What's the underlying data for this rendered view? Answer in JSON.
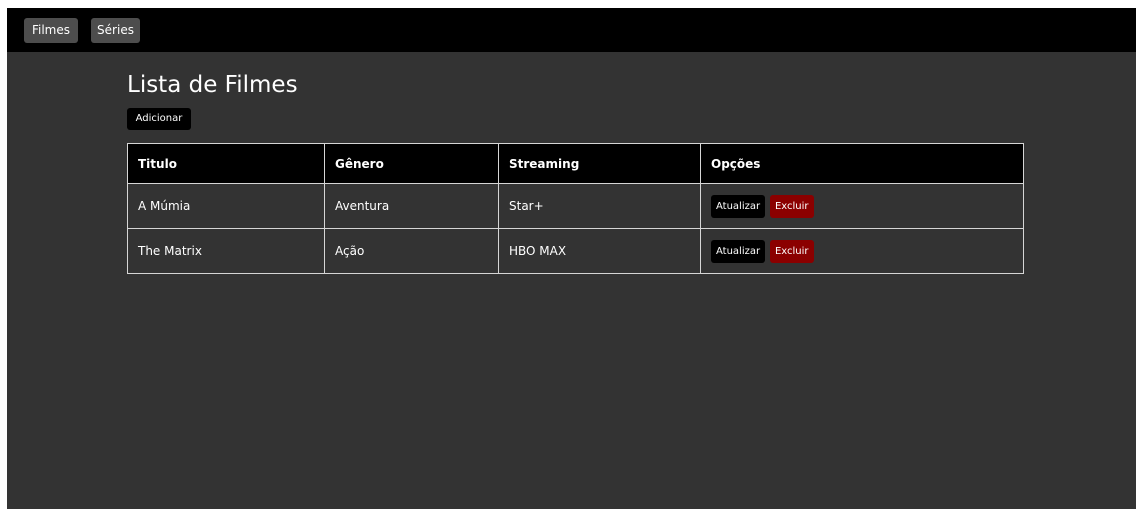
{
  "nav": {
    "filmes_label": "Filmes",
    "series_label": "Séries"
  },
  "page": {
    "title": "Lista de Filmes",
    "add_label": "Adicionar"
  },
  "table": {
    "headers": [
      "Titulo",
      "Gênero",
      "Streaming",
      "Opções"
    ],
    "rows": [
      {
        "titulo": "A Múmia",
        "genero": "Aventura",
        "streaming": "Star+",
        "update_label": "Atualizar",
        "delete_label": "Excluir"
      },
      {
        "titulo": "The Matrix",
        "genero": "Ação",
        "streaming": "HBO MAX",
        "update_label": "Atualizar",
        "delete_label": "Excluir"
      }
    ]
  },
  "colors": {
    "navbar_bg": "#000000",
    "page_bg": "#333333",
    "nav_button_bg": "#4d4d4d",
    "update_button_bg": "#000000",
    "delete_button_bg": "#8b0000"
  }
}
